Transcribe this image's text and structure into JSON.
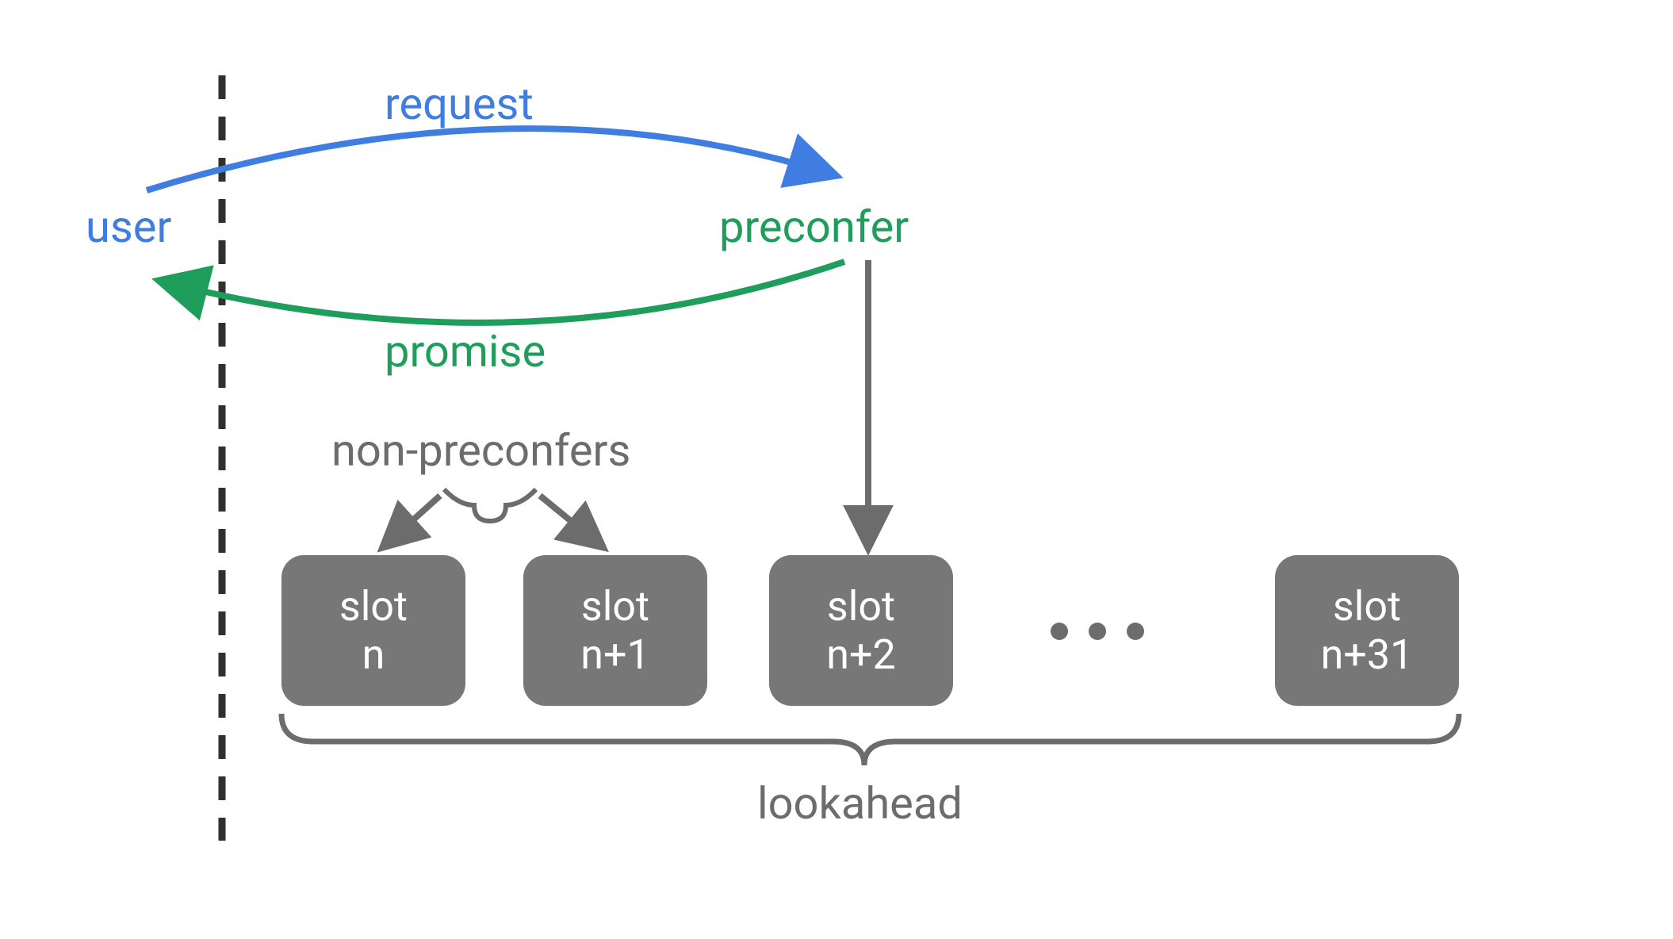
{
  "colors": {
    "blue": "#3f7de0",
    "green": "#1e9e5a",
    "gray": "#6c6c6c",
    "boxFill": "#777777",
    "white": "#ffffff"
  },
  "labels": {
    "user": "user",
    "preconfer": "preconfer",
    "request": "request",
    "promise": "promise",
    "nonPreconfers": "non-preconfers",
    "lookahead": "lookahead"
  },
  "slots": [
    {
      "line1": "slot",
      "line2": "n"
    },
    {
      "line1": "slot",
      "line2": "n+1"
    },
    {
      "line1": "slot",
      "line2": "n+2"
    },
    {
      "line1": "slot",
      "line2": "n+31"
    }
  ]
}
